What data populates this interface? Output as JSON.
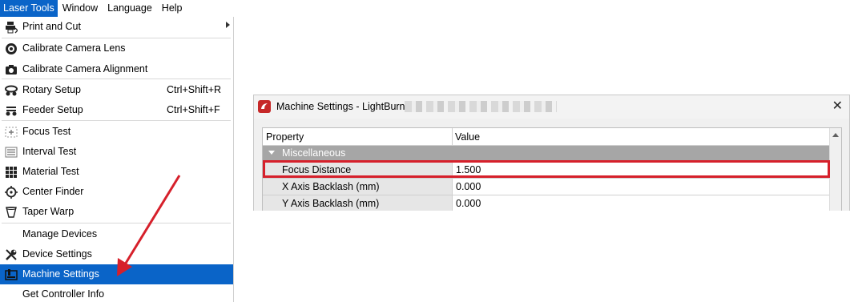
{
  "menubar": {
    "items": [
      "Laser Tools",
      "Window",
      "Language",
      "Help"
    ]
  },
  "menu": {
    "items": [
      {
        "label": "Print and Cut",
        "icon": "print-cut-icon",
        "shortcut": "",
        "submenu": true
      },
      {
        "label": "Calibrate Camera Lens",
        "icon": "lens-icon",
        "shortcut": ""
      },
      {
        "label": "Calibrate Camera Alignment",
        "icon": "camera-icon",
        "shortcut": ""
      },
      {
        "label": "Rotary Setup",
        "icon": "rotary-icon",
        "shortcut": "Ctrl+Shift+R"
      },
      {
        "label": "Feeder Setup",
        "icon": "feeder-icon",
        "shortcut": "Ctrl+Shift+F"
      },
      {
        "label": "Focus Test",
        "icon": "focus-test-icon",
        "shortcut": ""
      },
      {
        "label": "Interval Test",
        "icon": "interval-test-icon",
        "shortcut": ""
      },
      {
        "label": "Material Test",
        "icon": "material-test-icon",
        "shortcut": ""
      },
      {
        "label": "Center Finder",
        "icon": "center-finder-icon",
        "shortcut": ""
      },
      {
        "label": "Taper Warp",
        "icon": "taper-warp-icon",
        "shortcut": ""
      },
      {
        "label": "Manage Devices",
        "icon": "",
        "shortcut": ""
      },
      {
        "label": "Device Settings",
        "icon": "wrench-icon",
        "shortcut": ""
      },
      {
        "label": "Machine Settings",
        "icon": "machine-icon",
        "shortcut": "",
        "highlighted": true
      },
      {
        "label": "Get Controller Info",
        "icon": "",
        "shortcut": ""
      }
    ]
  },
  "dialog": {
    "title": "Machine Settings - LightBurn",
    "columns": [
      "Property",
      "Value"
    ],
    "group": "Miscellaneous",
    "rows": [
      {
        "property": "Focus Distance",
        "value": "1.500",
        "highlighted": true
      },
      {
        "property": "X Axis Backlash (mm)",
        "value": "0.000"
      },
      {
        "property": "Y Axis Backlash (mm)",
        "value": "0.000"
      }
    ]
  },
  "colors": {
    "menu_highlight": "#0a64c8",
    "annotation_red": "#d6202b",
    "group_row": "#a6a6a6"
  }
}
